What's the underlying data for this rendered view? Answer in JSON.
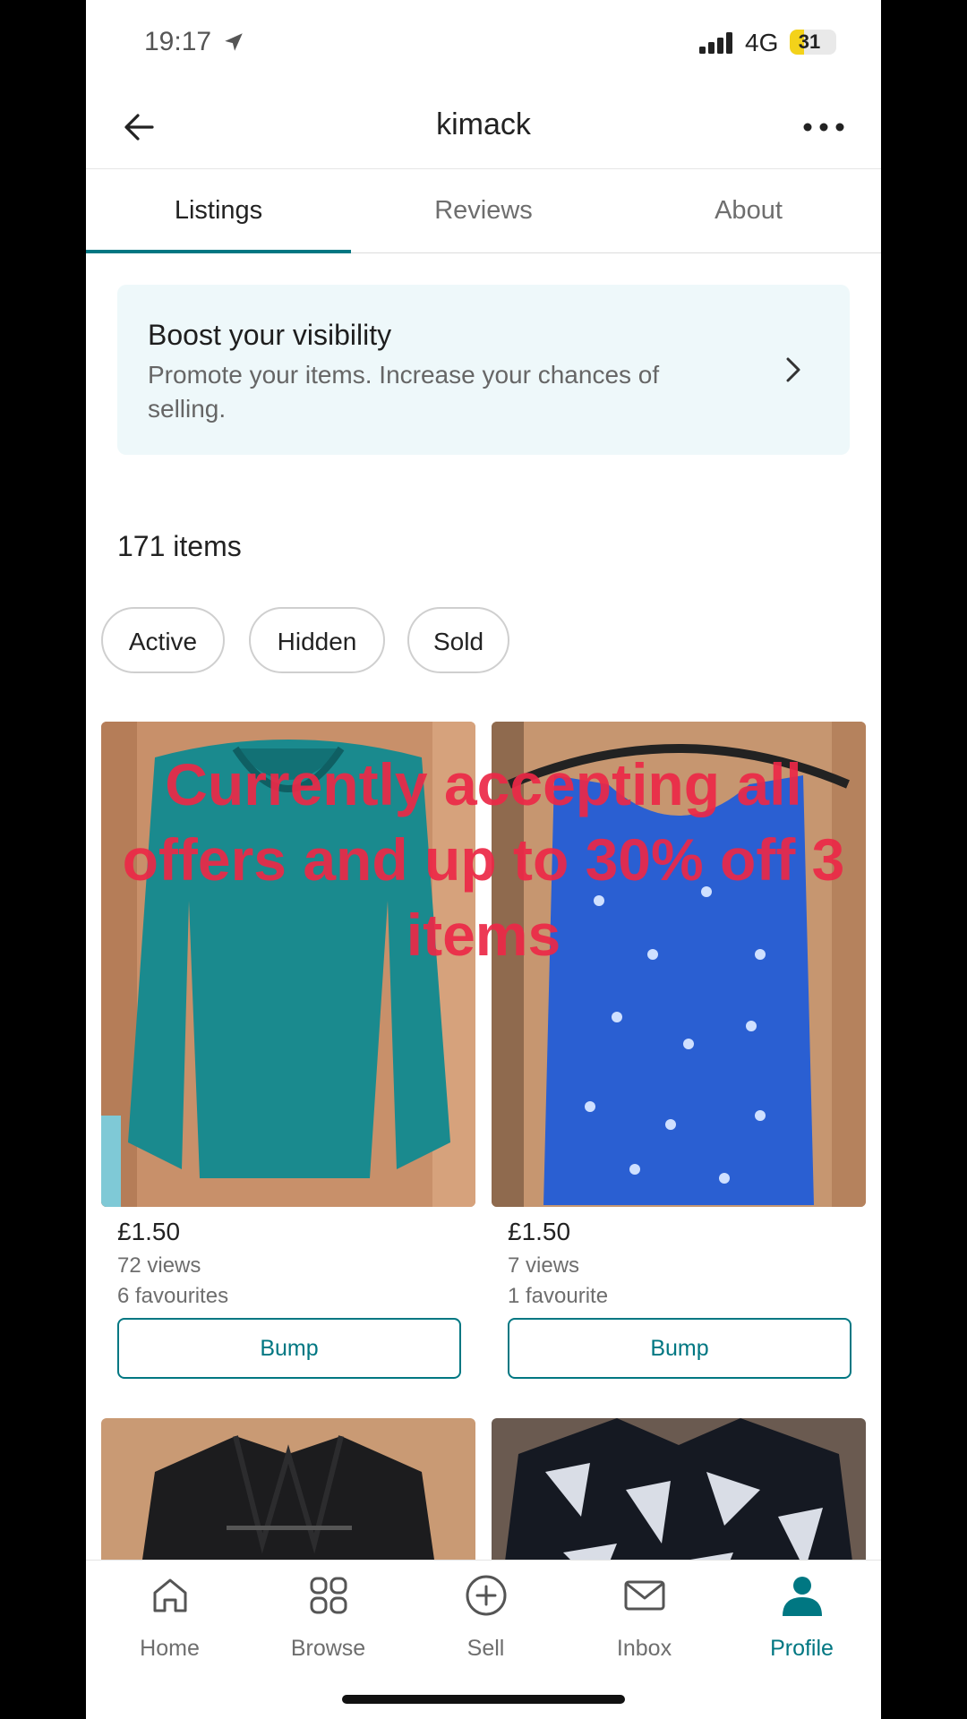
{
  "status_bar": {
    "time": "19:17",
    "network": "4G",
    "battery": "31",
    "battery_level_percent": 31,
    "location_icon": "location-arrow-icon",
    "signal_icon": "cellular-signal-icon"
  },
  "header": {
    "title": "kimack",
    "back_icon": "arrow-left-icon",
    "more_icon": "more-horizontal-icon"
  },
  "tabs": [
    {
      "label": "Listings",
      "active": true
    },
    {
      "label": "Reviews",
      "active": false
    },
    {
      "label": "About",
      "active": false
    }
  ],
  "boost": {
    "title": "Boost your visibility",
    "description": "Promote your items. Increase your chances of selling.",
    "icon": "chevron-right-icon"
  },
  "items_count": "171 items",
  "filters": [
    "Active",
    "Hidden",
    "Sold"
  ],
  "listings": [
    {
      "price": "£1.50",
      "views": "72 views",
      "favourites": "6 favourites",
      "button": "Bump",
      "image": "teal long-sleeve knit top on hanger"
    },
    {
      "price": "£1.50",
      "views": "7 views",
      "favourites": "1 favourite",
      "button": "Bump",
      "image": "blue sleeveless top with white palm print"
    },
    {
      "image": "black jacket on hanger"
    },
    {
      "image": "black and white patterned shirt"
    }
  ],
  "overlay_caption": "Currently accepting all offers and up to 30% off 3 items",
  "bottom_nav": [
    {
      "label": "Home",
      "icon": "home-icon",
      "active": false
    },
    {
      "label": "Browse",
      "icon": "grid-icon",
      "active": false
    },
    {
      "label": "Sell",
      "icon": "plus-circle-icon",
      "active": false
    },
    {
      "label": "Inbox",
      "icon": "mail-icon",
      "active": false
    },
    {
      "label": "Profile",
      "icon": "person-icon",
      "active": true
    }
  ],
  "colors": {
    "accent": "#007782",
    "boost_background": "#eef8fa",
    "overlay_text": "#ec2846"
  }
}
